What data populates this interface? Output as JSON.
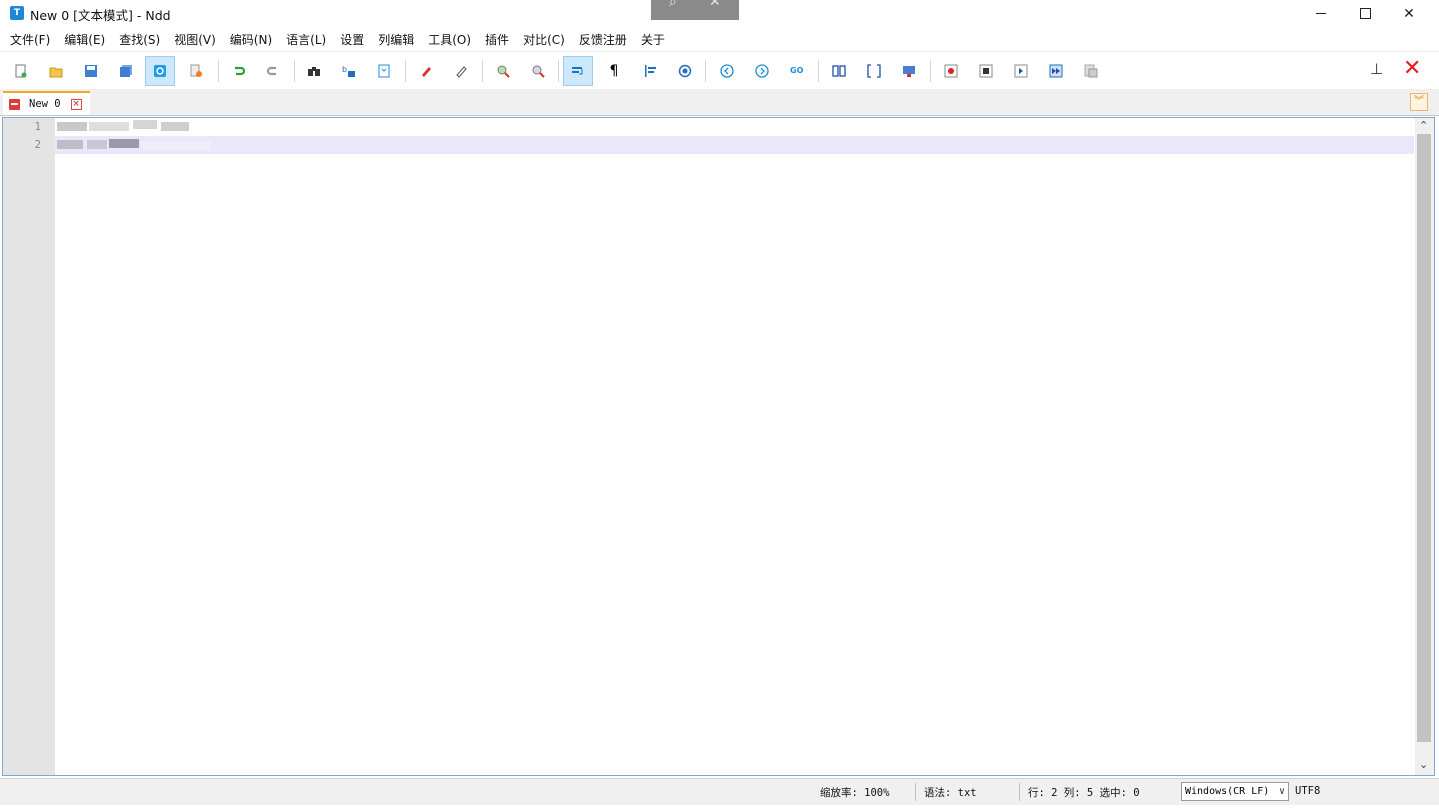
{
  "window": {
    "title": "New 0 [文本模式] - Ndd",
    "app_icon": "T"
  },
  "menu": [
    "文件(F)",
    "编辑(E)",
    "查找(S)",
    "视图(V)",
    "编码(N)",
    "语言(L)",
    "设置",
    "列编辑",
    "工具(O)",
    "插件",
    "对比(C)",
    "反馈注册",
    "关于"
  ],
  "tabs": [
    {
      "label": "New 0"
    }
  ],
  "editor": {
    "line_numbers": [
      "1",
      "2"
    ],
    "current_line": 2
  },
  "status": {
    "zoom": "缩放率: 100%",
    "syntax": "语法: txt",
    "position": "行: 2 列: 5 选中: 0",
    "eol": "Windows(CR LF)",
    "encoding": "UTF8"
  },
  "colors": {
    "accent": "#1e88d8",
    "tab_accent": "#f5a623",
    "close_red": "#e02020",
    "current_line": "#e8e8fa"
  }
}
